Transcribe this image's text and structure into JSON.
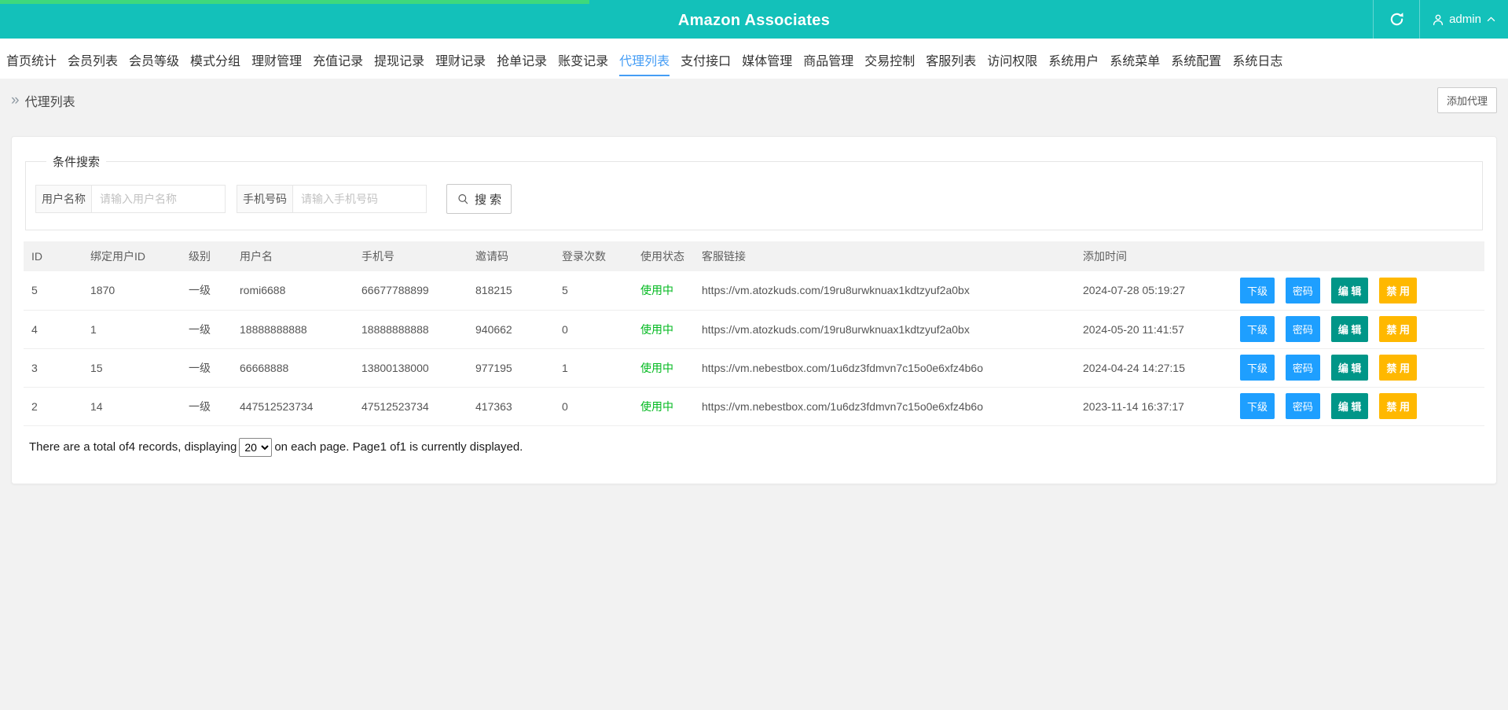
{
  "brand": {
    "title": "Amazon Associates"
  },
  "topbar": {
    "username": "admin"
  },
  "nav": {
    "active_index": 10,
    "items": [
      "首页统计",
      "会员列表",
      "会员等级",
      "模式分组",
      "理财管理",
      "充值记录",
      "提现记录",
      "理财记录",
      "抢单记录",
      "账变记录",
      "代理列表",
      "支付接口",
      "媒体管理",
      "商品管理",
      "交易控制",
      "客服列表",
      "访问权限",
      "系统用户",
      "系统菜单",
      "系统配置",
      "系统日志"
    ]
  },
  "page": {
    "breadcrumb": "代理列表",
    "add_button": "添加代理"
  },
  "search": {
    "legend": "条件搜索",
    "fields": [
      {
        "label": "用户名称",
        "placeholder": "请输入用户名称"
      },
      {
        "label": "手机号码",
        "placeholder": "请输入手机号码"
      }
    ],
    "submit": "搜 索"
  },
  "table": {
    "columns": [
      "ID",
      "绑定用户ID",
      "级别",
      "用户名",
      "手机号",
      "邀请码",
      "登录次数",
      "使用状态",
      "客服链接",
      "添加时间",
      ""
    ],
    "rows": [
      {
        "id": "5",
        "bind_uid": "1870",
        "level": "一级",
        "username": "romi6688",
        "phone": "66677788899",
        "invite": "818215",
        "logins": "5",
        "status": "使用中",
        "link": "https://vm.atozkuds.com/19ru8urwknuax1kdtzyuf2a0bx",
        "added": "2024-07-28 05:19:27"
      },
      {
        "id": "4",
        "bind_uid": "1",
        "level": "一级",
        "username": "18888888888",
        "phone": "18888888888",
        "invite": "940662",
        "logins": "0",
        "status": "使用中",
        "link": "https://vm.atozkuds.com/19ru8urwknuax1kdtzyuf2a0bx",
        "added": "2024-05-20 11:41:57"
      },
      {
        "id": "3",
        "bind_uid": "15",
        "level": "一级",
        "username": "66668888",
        "phone": "13800138000",
        "invite": "977195",
        "logins": "1",
        "status": "使用中",
        "link": "https://vm.nebestbox.com/1u6dz3fdmvn7c15o0e6xfz4b6o",
        "added": "2024-04-24 14:27:15"
      },
      {
        "id": "2",
        "bind_uid": "14",
        "level": "一级",
        "username": "447512523734",
        "phone": "47512523734",
        "invite": "417363",
        "logins": "0",
        "status": "使用中",
        "link": "https://vm.nebestbox.com/1u6dz3fdmvn7c15o0e6xfz4b6o",
        "added": "2023-11-14 16:37:17"
      }
    ],
    "actions": [
      {
        "label": "下级"
      },
      {
        "label": "密码"
      },
      {
        "label": "编 辑"
      },
      {
        "label": "禁 用"
      }
    ]
  },
  "pagination": {
    "before": "There are a total of4 records, displaying",
    "per_page": "20",
    "after": "on each page. Page1 of1 is currently displayed."
  },
  "colors": {
    "header_teal": "#13c1ba",
    "progress_green": "#3ed97c",
    "nav_active_blue": "#459df5",
    "status_green": "#00b91e",
    "button_blue": "#1E9FFF",
    "button_green": "#009688",
    "button_yellow": "#FFB800"
  }
}
